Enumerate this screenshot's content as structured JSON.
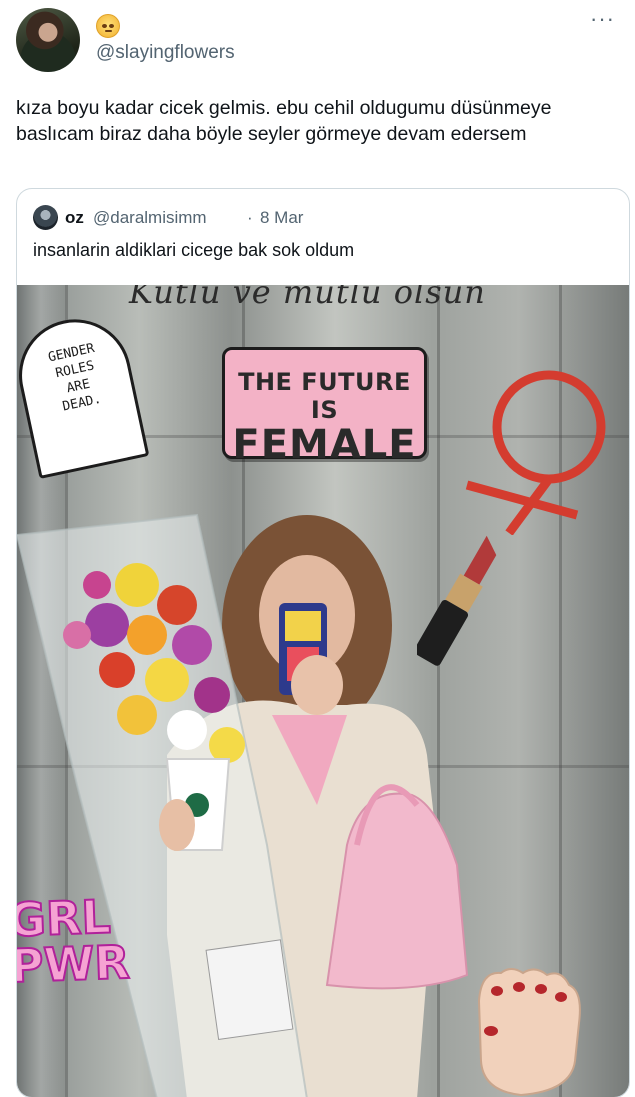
{
  "tweet": {
    "author_handle": "@slayingflowers",
    "more_icon": "more-icon",
    "text": "kıza boyu kadar cicek gelmis. ebu cehil oldugumu düsünmeye baslıcam biraz daha böyle seyler görmeye devam edersem"
  },
  "quoted": {
    "name": "oz",
    "handle": "@daralmisimm",
    "separator": "·",
    "date": "8 Mar",
    "text": "insanlarin aldiklari cicege bak sok oldum",
    "image": {
      "overlay_script": "Kutlu ve mutlu olsun",
      "sticker_future_line1": "THE FUTURE IS",
      "sticker_future_line2": "FEMALE",
      "tombstone_lines": [
        "GENDER",
        "ROLES",
        "ARE",
        "DEAD."
      ],
      "grl_lines": [
        "GRL",
        "PWR"
      ]
    }
  },
  "colors": {
    "text_primary": "#0f1419",
    "text_secondary": "#536471",
    "border": "#cfd9de",
    "sticker_pink": "#f3b2c6",
    "grl_pink": "#f5a3d3",
    "venus_red": "#d43c2f"
  }
}
